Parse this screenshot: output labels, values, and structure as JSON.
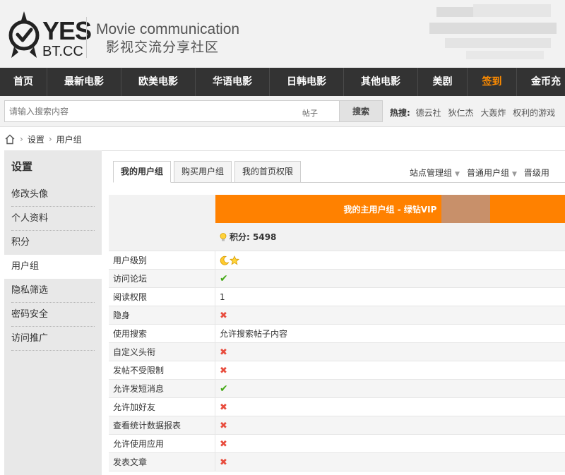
{
  "header": {
    "logo_text": "YES",
    "logo_subtext": "BT.CC",
    "slogan_en": "Movie communication",
    "slogan_cn": "影视交流分享社区"
  },
  "nav": {
    "items": [
      {
        "label": "首页"
      },
      {
        "label": "最新电影"
      },
      {
        "label": "欧美电影"
      },
      {
        "label": "华语电影"
      },
      {
        "label": "日韩电影"
      },
      {
        "label": "其他电影"
      },
      {
        "label": "美剧"
      },
      {
        "label": "签到"
      },
      {
        "label": "金币充"
      }
    ]
  },
  "search": {
    "placeholder": "请输入搜索内容",
    "type": "帖子",
    "button": "搜索",
    "hot_label": "热搜:",
    "hot_links": [
      "德云社",
      "狄仁杰",
      "大轰炸",
      "权利的游戏"
    ]
  },
  "breadcrumb": {
    "items": [
      "设置",
      "用户组"
    ]
  },
  "sidebar": {
    "title": "设置",
    "items": [
      {
        "label": "修改头像"
      },
      {
        "label": "个人资料"
      },
      {
        "label": "积分"
      },
      {
        "label": "用户组"
      },
      {
        "label": "隐私筛选"
      },
      {
        "label": "密码安全"
      },
      {
        "label": "访问推广"
      }
    ]
  },
  "tabs": {
    "items": [
      {
        "label": "我的用户组"
      },
      {
        "label": "购买用户组"
      },
      {
        "label": "我的首页权限"
      }
    ],
    "groups": [
      {
        "label": "站点管理组"
      },
      {
        "label": "普通用户组"
      },
      {
        "label": "晋级用"
      }
    ]
  },
  "group_table": {
    "title": "我的主用户组 - 绿钻VIP",
    "points_label": "积分:",
    "points_value": "5498",
    "rows": [
      {
        "label": "用户级别",
        "value": "",
        "icon": "moon-star-icon"
      },
      {
        "label": "访问论坛",
        "value": "",
        "icon": "check-icon"
      },
      {
        "label": "阅读权限",
        "value": "1",
        "icon": ""
      },
      {
        "label": "隐身",
        "value": "",
        "icon": "cross-icon"
      },
      {
        "label": "使用搜索",
        "value": "允许搜索帖子内容",
        "icon": ""
      },
      {
        "label": "自定义头衔",
        "value": "",
        "icon": "cross-icon"
      },
      {
        "label": "发帖不受限制",
        "value": "",
        "icon": "cross-icon"
      },
      {
        "label": "允许发短消息",
        "value": "",
        "icon": "check-icon"
      },
      {
        "label": "允许加好友",
        "value": "",
        "icon": "cross-icon"
      },
      {
        "label": "查看统计数据报表",
        "value": "",
        "icon": "cross-icon"
      },
      {
        "label": "允许使用应用",
        "value": "",
        "icon": "cross-icon"
      },
      {
        "label": "发表文章",
        "value": "",
        "icon": "cross-icon"
      }
    ]
  },
  "colors": {
    "nav_bg": "#333333",
    "accent_orange": "#ff8100",
    "check_green": "#44a815",
    "cross_red": "#e84c3d"
  }
}
